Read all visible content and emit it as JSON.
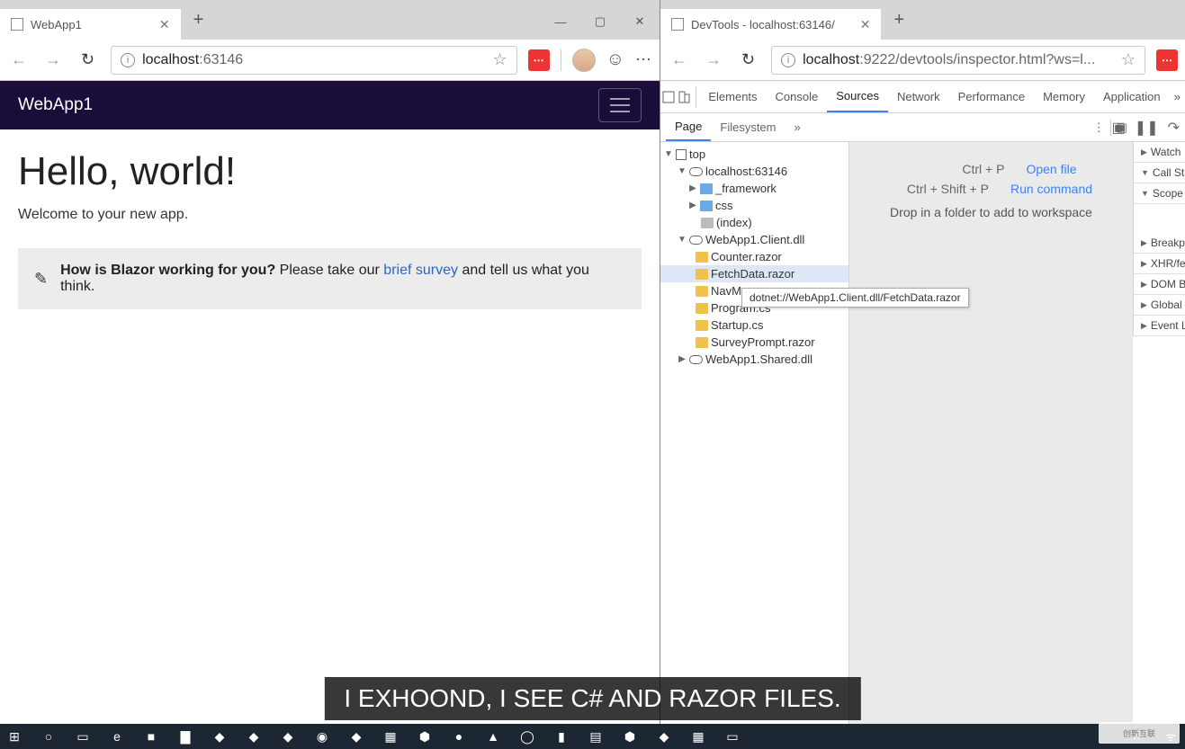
{
  "left": {
    "tab_title": "WebApp1",
    "address_host": "localhost",
    "address_port": ":63146",
    "navbar_title": "WebApp1",
    "page_heading": "Hello, world!",
    "welcome": "Welcome to your new app.",
    "survey_prefix": "How is Blazor working for you?",
    "survey_mid": " Please take our ",
    "survey_link": "brief survey",
    "survey_suffix": " and tell us what you think."
  },
  "right": {
    "tab_title": "DevTools - localhost:63146/",
    "address_host": "localhost",
    "address_rest": ":9222/devtools/inspector.html?ws=l...",
    "tools": [
      "Elements",
      "Console",
      "Sources",
      "Network",
      "Performance",
      "Memory",
      "Application"
    ],
    "active_tool": "Sources",
    "subtabs": [
      "Page",
      "Filesystem"
    ],
    "active_subtab": "Page",
    "tree": {
      "top": "top",
      "host": "localhost:63146",
      "framework": "_framework",
      "css": "css",
      "index": "(index)",
      "client": "WebApp1.Client.dll",
      "files": [
        "Counter.razor",
        "FetchData.razor",
        "NavMenu.razor",
        "Program.cs",
        "Startup.cs",
        "SurveyPrompt.razor"
      ],
      "shared": "WebApp1.Shared.dll"
    },
    "tooltip": "dotnet://WebApp1.Client.dll/FetchData.razor",
    "hints": {
      "open_keys": "Ctrl + P",
      "open_label": "Open file",
      "cmd_keys": "Ctrl + Shift + P",
      "cmd_label": "Run command",
      "drop": "Drop in a folder to add to workspace"
    },
    "side_sections": [
      "Watch",
      "Call Stack",
      "Scope",
      "Breakpoints",
      "XHR/fetch",
      "DOM Breakpoints",
      "Global Listeners",
      "Event Listeners"
    ]
  },
  "caption": "I EXHOOND, I SEE C# AND RAZOR FILES.",
  "watermark": "创新互联"
}
